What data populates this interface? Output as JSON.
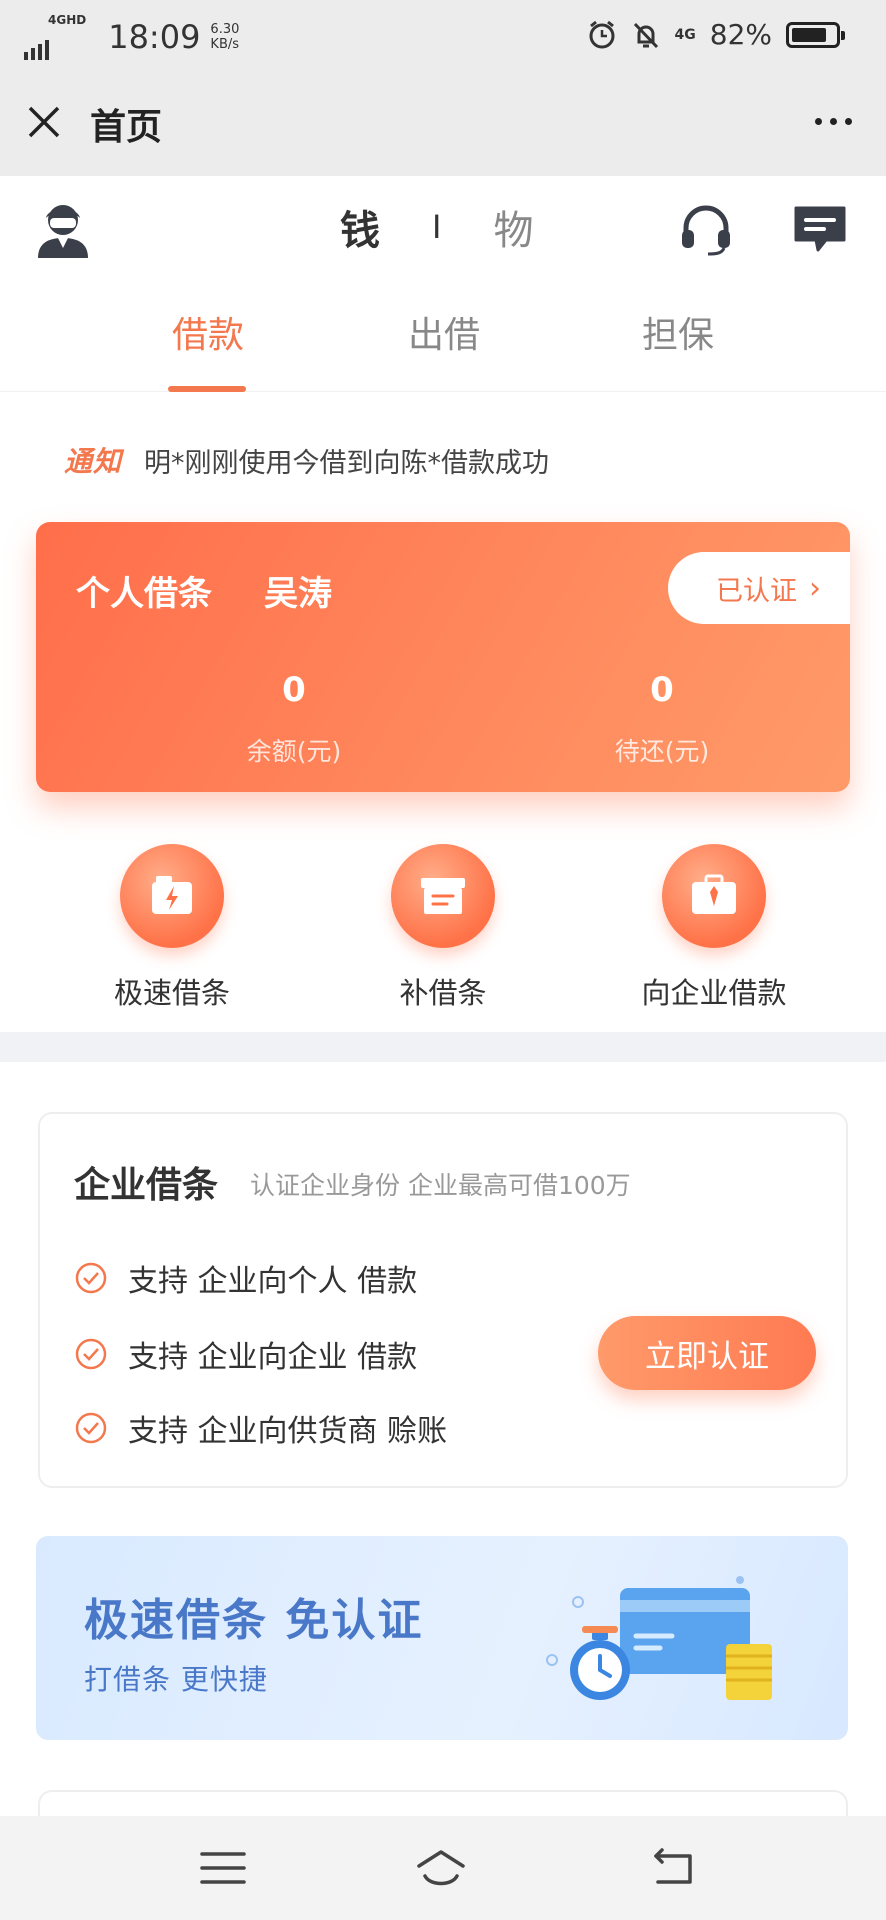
{
  "status_bar": {
    "network": "4GHD",
    "time": "18:09",
    "speed_value": "6.30",
    "speed_unit": "KB/s",
    "network_right": "4G",
    "battery_pct": "82%",
    "battery_level": 0.82
  },
  "title_bar": {
    "title": "首页"
  },
  "header": {
    "segment_active": "钱",
    "segment_separator": "I",
    "segment_other": "物",
    "tabs": [
      {
        "label": "借款",
        "active": true
      },
      {
        "label": "出借",
        "active": false
      },
      {
        "label": "担保",
        "active": false
      }
    ]
  },
  "notice": {
    "tag": "通知",
    "text": "明*刚刚使用今借到向陈*借款成功"
  },
  "loan_card": {
    "title": "个人借条",
    "name": "吴涛",
    "verified_label": "已认证",
    "balance_value": "0",
    "balance_label": "余额(元)",
    "due_value": "0",
    "due_label": "待还(元)"
  },
  "quick_actions": [
    {
      "label": "极速借条",
      "icon": "flash-folder-icon"
    },
    {
      "label": "补借条",
      "icon": "document-box-icon"
    },
    {
      "label": "向企业借款",
      "icon": "briefcase-icon"
    }
  ],
  "enterprise": {
    "title": "企业借条",
    "subtitle": "认证企业身份 企业最高可借100万",
    "features": [
      "支持 企业向个人 借款",
      "支持 企业向企业 借款",
      "支持 企业向供货商 赊账"
    ],
    "button": "立即认证"
  },
  "banner": {
    "title": "极速借条 免认证",
    "subtitle": "打借条 更快捷"
  },
  "colors": {
    "accent": "#f4784e",
    "banner_text": "#4a78c8"
  }
}
